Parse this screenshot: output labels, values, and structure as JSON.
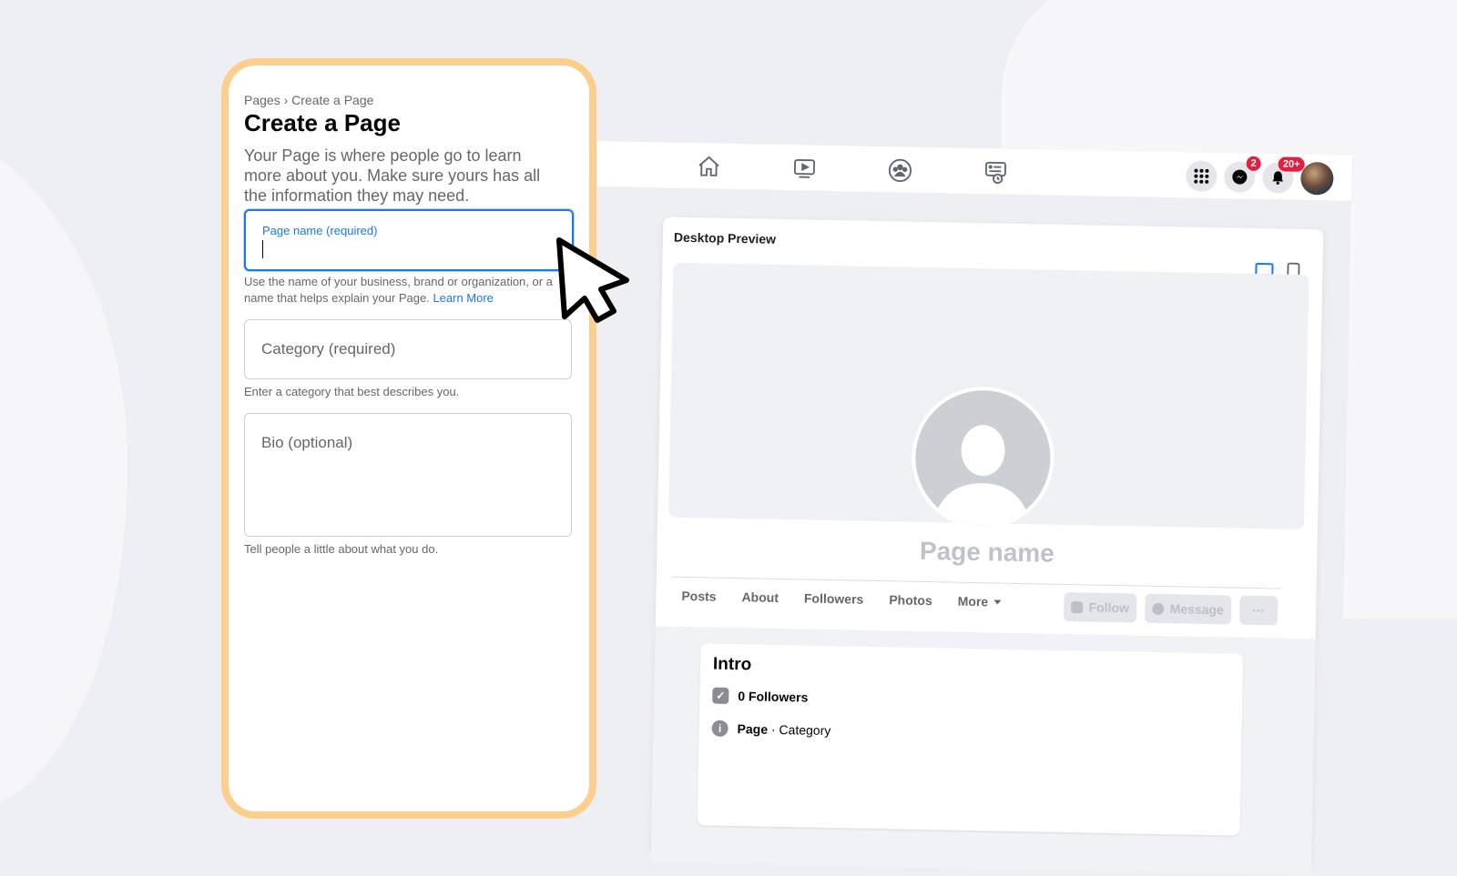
{
  "form": {
    "breadcrumb": "Pages › Create a Page",
    "title": "Create a Page",
    "description": "Your Page is where people go to learn more about you. Make sure yours has all the information they may need.",
    "page_name": {
      "label": "Page name (required)",
      "value": "",
      "helper": "Use the name of your business, brand or organization, or a name that helps explain your Page.",
      "helper_link": "Learn More"
    },
    "category": {
      "placeholder": "Category (required)",
      "helper": "Enter a category that best describes you."
    },
    "bio": {
      "placeholder": "Bio (optional)",
      "helper": "Tell people a little about what you do."
    }
  },
  "topbar": {
    "nav_icons": [
      "home-icon",
      "watch-icon",
      "groups-icon",
      "pages-feed-icon"
    ],
    "messenger_badge": "2",
    "notifications_badge": "20+"
  },
  "preview": {
    "title": "Desktop Preview",
    "page_name": "Page name",
    "tabs": [
      "Posts",
      "About",
      "Followers",
      "Photos",
      "More"
    ],
    "follow_label": "Follow",
    "message_label": "Message",
    "more_label": "···",
    "intro": {
      "title": "Intro",
      "followers": "0 Followers",
      "page_label": "Page",
      "category_label": " · Category"
    }
  },
  "colors": {
    "accent": "#1877f2",
    "panel_border": "#fdcf8f",
    "badge": "#e41e3f"
  }
}
